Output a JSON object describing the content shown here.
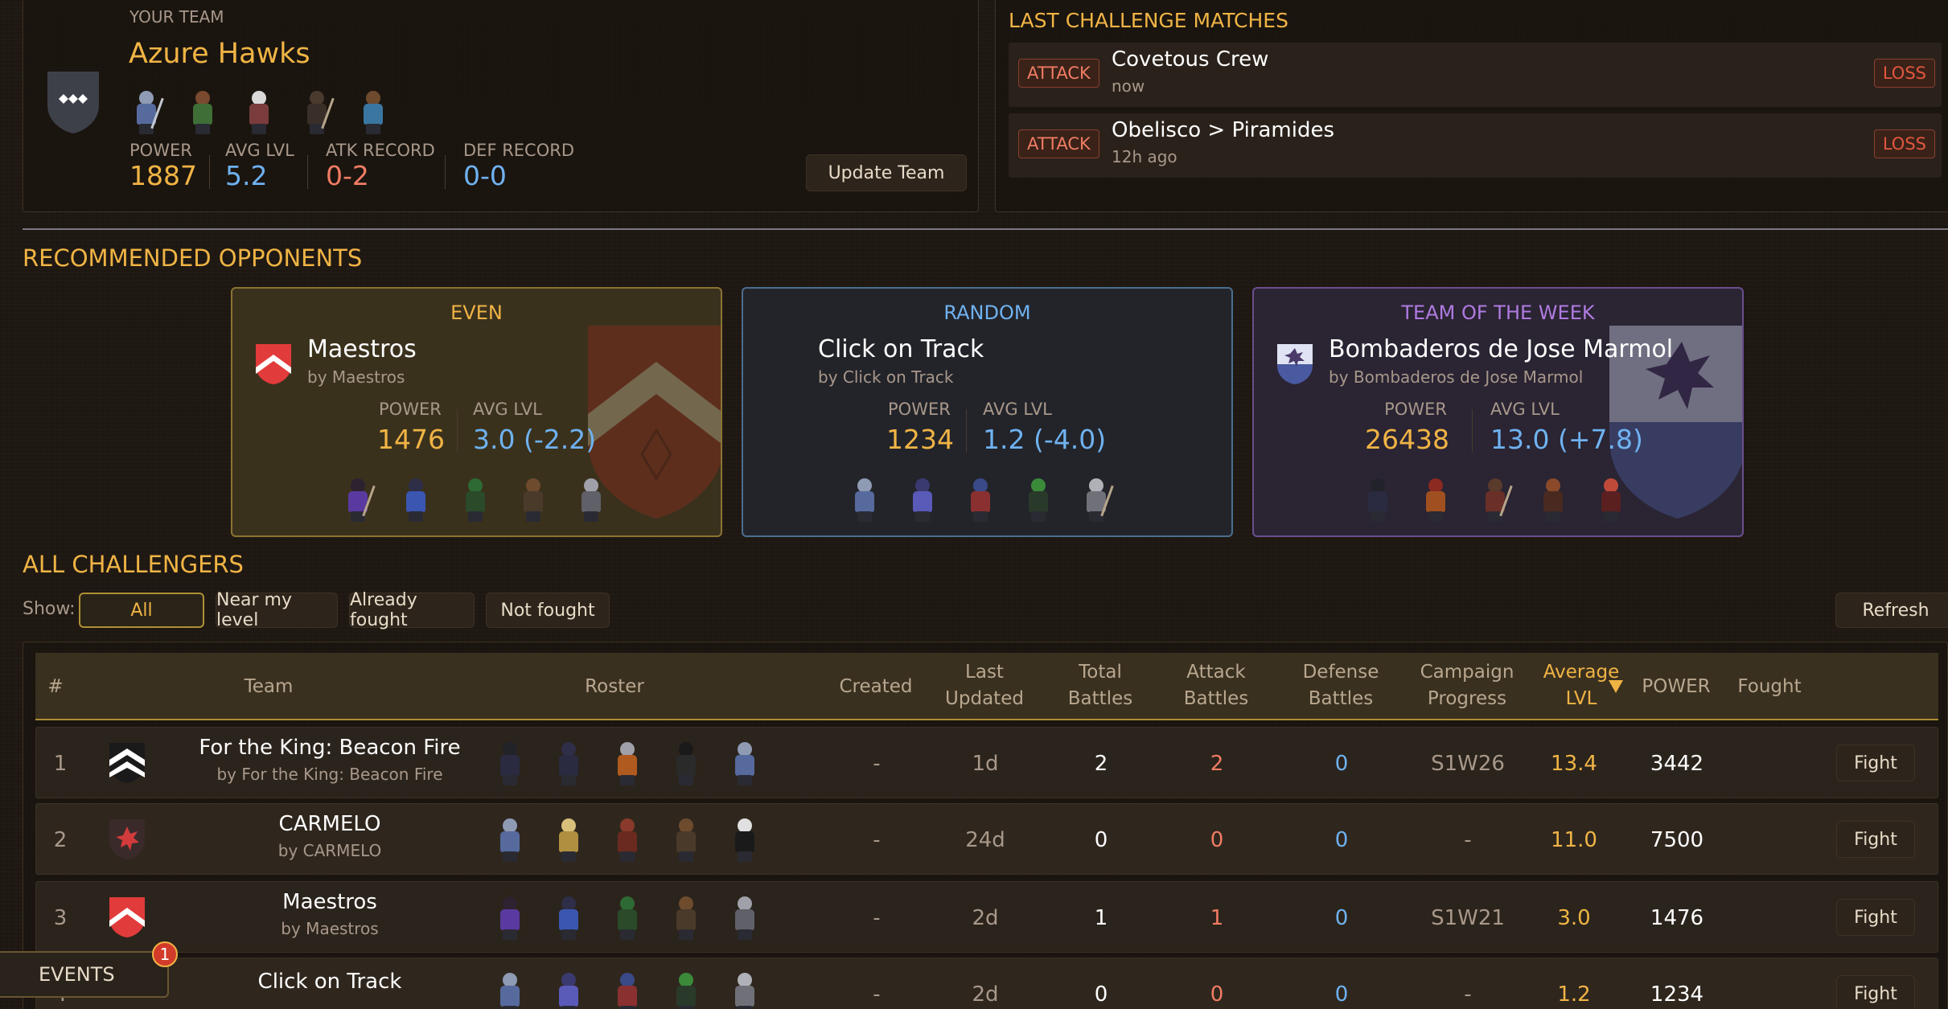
{
  "your_team": {
    "label": "YOUR TEAM",
    "name": "Azure Hawks",
    "power_label": "POWER",
    "power": "1887",
    "avg_lvl_label": "AVG LVL",
    "avg_lvl": "5.2",
    "atk_label": "ATK RECORD",
    "atk": "0-2",
    "def_label": "DEF RECORD",
    "def": "0-0",
    "update_button": "Update Team",
    "icons": [
      "shield-icon"
    ]
  },
  "last_matches": {
    "title": "LAST CHALLENGE MATCHES",
    "items": [
      {
        "tag": "ATTACK",
        "name": "Covetous Crew",
        "time": "now",
        "result": "LOSS"
      },
      {
        "tag": "ATTACK",
        "name": "Obelisco > Piramides",
        "time": "12h ago",
        "result": "LOSS"
      }
    ]
  },
  "recommended": {
    "title": "RECOMMENDED OPPONENTS",
    "cards": [
      {
        "kind": "EVEN",
        "name": "Maestros",
        "by": "by Maestros",
        "power_label": "POWER",
        "power": "1476",
        "avg_label": "AVG LVL",
        "avg": "3.0 (-2.2)"
      },
      {
        "kind": "RANDOM",
        "name": "Click on Track",
        "by": "by Click on Track",
        "power_label": "POWER",
        "power": "1234",
        "avg_label": "AVG LVL",
        "avg": "1.2 (-4.0)"
      },
      {
        "kind": "TEAM OF THE WEEK",
        "name": "Bombaderos de Jose Marmol",
        "by": "by Bombaderos de Jose Marmol",
        "power_label": "POWER",
        "power": "26438",
        "avg_label": "AVG LVL",
        "avg": "13.0 (+7.8)"
      }
    ]
  },
  "challengers": {
    "title": "ALL CHALLENGERS",
    "show_label": "Show:",
    "filters": [
      "All",
      "Near my level",
      "Already fought",
      "Not fought"
    ],
    "active_filter": "All",
    "refresh": "Refresh",
    "headers": {
      "num": "#",
      "team": "Team",
      "roster": "Roster",
      "created": "Created",
      "last_updated": "Last Updated",
      "total": "Total Battles",
      "attack": "Attack Battles",
      "defense": "Defense Battles",
      "campaign": "Campaign Progress",
      "avg": "Average LVL",
      "power": "POWER",
      "fought": "Fought"
    },
    "sort_icon": "sort-desc-icon",
    "fight_label": "Fight",
    "rows": [
      {
        "num": "1",
        "name": "For the King: Beacon Fire",
        "by": "by For the King: Beacon Fire",
        "created": "-",
        "updated": "1d",
        "total": "2",
        "attack": "2",
        "defense": "0",
        "campaign": "S1W26",
        "avg": "13.4",
        "power": "3442"
      },
      {
        "num": "2",
        "name": "CARMELO",
        "by": "by CARMELO",
        "created": "-",
        "updated": "24d",
        "total": "0",
        "attack": "0",
        "defense": "0",
        "campaign": "-",
        "avg": "11.0",
        "power": "7500"
      },
      {
        "num": "3",
        "name": "Maestros",
        "by": "by Maestros",
        "created": "-",
        "updated": "2d",
        "total": "1",
        "attack": "1",
        "defense": "0",
        "campaign": "S1W21",
        "avg": "3.0",
        "power": "1476"
      },
      {
        "num": "4",
        "name": "Click on Track",
        "by": "",
        "created": "-",
        "updated": "2d",
        "total": "0",
        "attack": "0",
        "defense": "0",
        "campaign": "-",
        "avg": "1.2",
        "power": "1234"
      }
    ]
  },
  "events": {
    "label": "EVENTS",
    "badge": "1"
  },
  "colors": {
    "gold": "#f0b445",
    "blue": "#6fb2f0",
    "red": "#f07c64",
    "purple": "#b07be0",
    "loss": "#e0573f"
  }
}
